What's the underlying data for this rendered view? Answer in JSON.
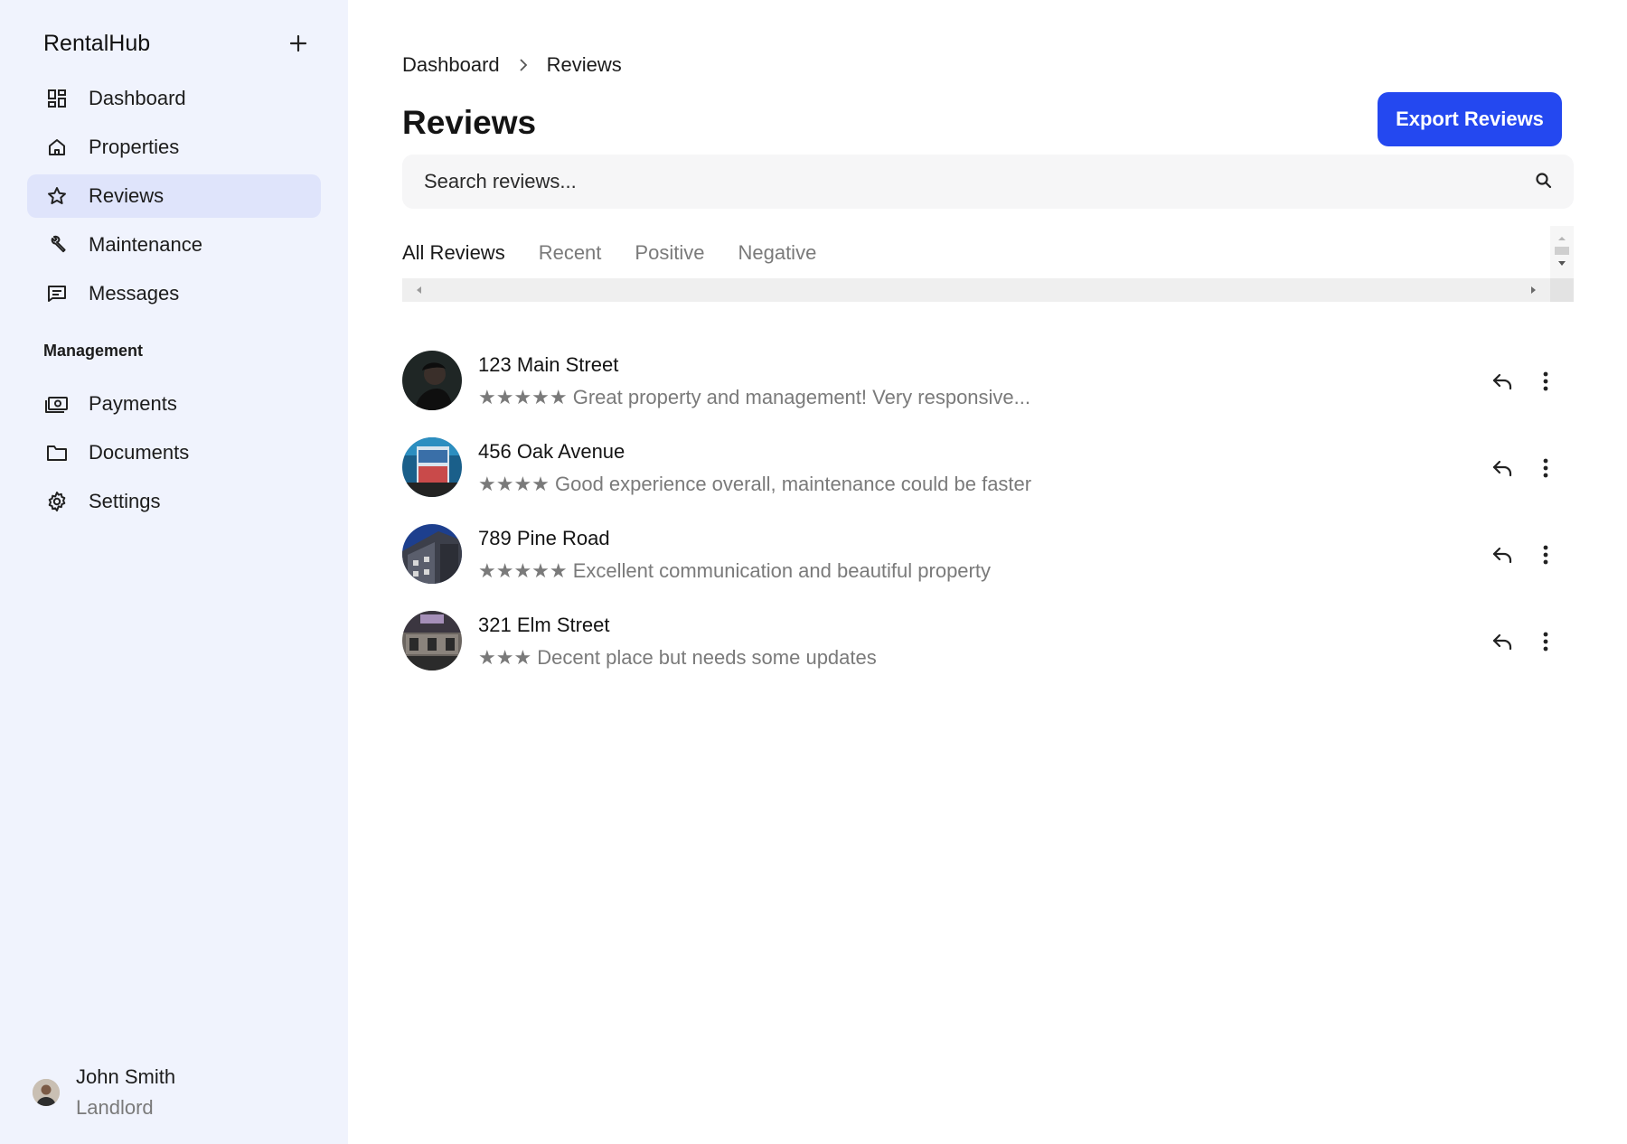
{
  "sidebar": {
    "brand": "RentalHub",
    "add_icon": "plus-icon",
    "nav": [
      {
        "label": "Dashboard",
        "icon": "dashboard-icon",
        "active": false
      },
      {
        "label": "Properties",
        "icon": "home-icon",
        "active": false
      },
      {
        "label": "Reviews",
        "icon": "star-icon",
        "active": true
      },
      {
        "label": "Maintenance",
        "icon": "wrench-icon",
        "active": false
      },
      {
        "label": "Messages",
        "icon": "message-icon",
        "active": false
      }
    ],
    "section_title": "Management",
    "management": [
      {
        "label": "Payments",
        "icon": "payments-icon"
      },
      {
        "label": "Documents",
        "icon": "folder-icon"
      },
      {
        "label": "Settings",
        "icon": "gear-icon"
      }
    ],
    "user": {
      "name": "John Smith",
      "role": "Landlord"
    },
    "active_bg": "#dfe4fb",
    "bg": "#f0f3fd"
  },
  "main": {
    "breadcrumb": [
      "Dashboard",
      "Reviews"
    ],
    "title": "Reviews",
    "export_label": "Export Reviews",
    "accent": "#2448f0",
    "search": {
      "placeholder": "Search reviews...",
      "value": ""
    },
    "tabs": [
      {
        "label": "All Reviews",
        "active": true
      },
      {
        "label": "Recent",
        "active": false
      },
      {
        "label": "Positive",
        "active": false
      },
      {
        "label": "Negative",
        "active": false
      }
    ],
    "reviews": [
      {
        "title": "123 Main Street",
        "text": "★★★★★ Great property and management! Very responsive..."
      },
      {
        "title": "456 Oak Avenue",
        "text": "★★★★ Good experience overall, maintenance could be faster"
      },
      {
        "title": "789 Pine Road",
        "text": "★★★★★ Excellent communication and beautiful property"
      },
      {
        "title": "321 Elm Street",
        "text": "★★★ Decent place but needs some updates"
      }
    ]
  }
}
